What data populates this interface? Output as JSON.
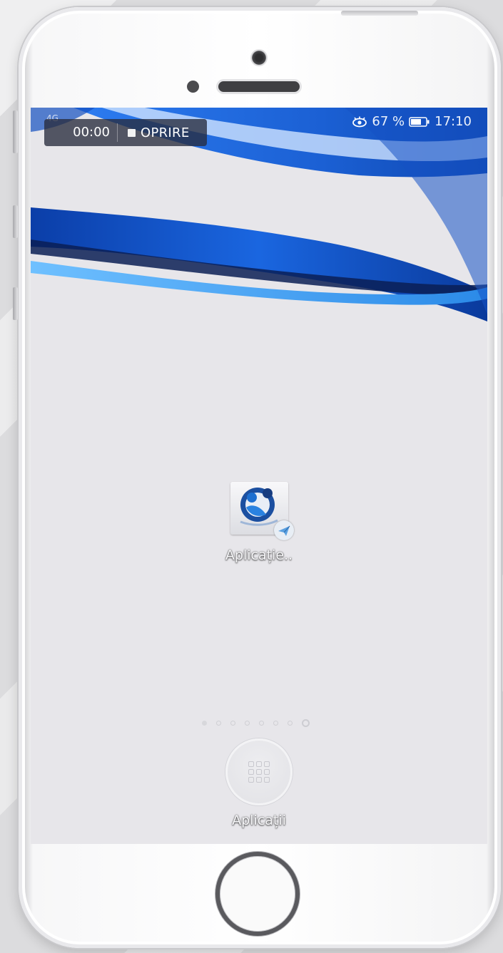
{
  "status_bar": {
    "signal_text": "4G",
    "battery_percent": "67 %",
    "time": "17:10"
  },
  "recorder": {
    "timer": "00:00",
    "stop_label": "OPRIRE"
  },
  "home_screen": {
    "app_label": "Aplicație..",
    "page_count": 8,
    "active_page": 8,
    "drawer_label": "Aplicații"
  },
  "colors": {
    "wallpaper_blue": "#1a5fd6",
    "screen_bg": "#e7e6ea"
  }
}
